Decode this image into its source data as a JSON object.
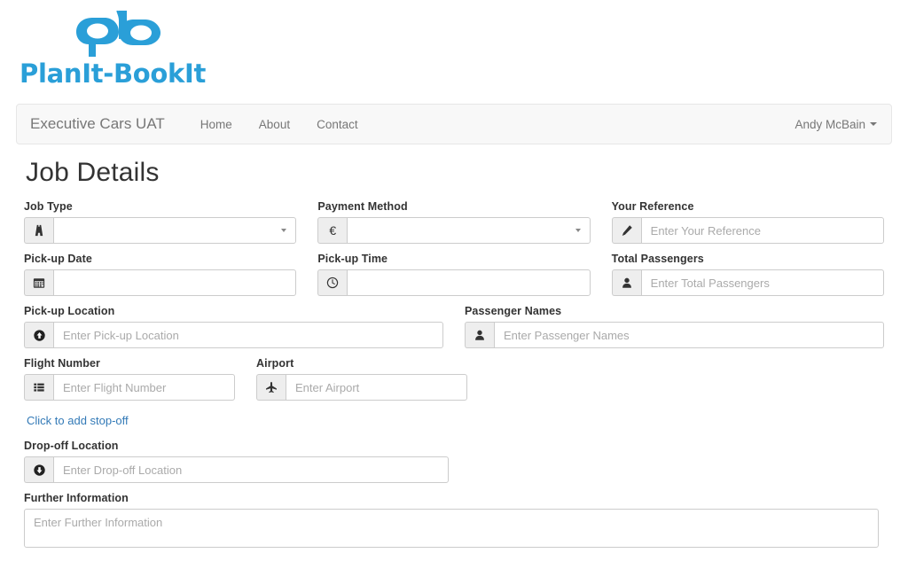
{
  "brand": {
    "logo_text": "PlanIt-BookIt",
    "logo_color": "#2a9fd8",
    "logo_icon": "pb-monogram-icon"
  },
  "navbar": {
    "brand": "Executive Cars UAT",
    "links": [
      {
        "label": "Home"
      },
      {
        "label": "About"
      },
      {
        "label": "Contact"
      }
    ],
    "user": "Andy McBain",
    "user_caret_icon": "chevron-down-icon"
  },
  "page": {
    "title": "Job Details"
  },
  "form": {
    "job_type": {
      "label": "Job Type",
      "icon": "road-icon",
      "value": "",
      "control": "select"
    },
    "payment_method": {
      "label": "Payment Method",
      "icon": "euro-icon",
      "icon_glyph": "€",
      "value": "",
      "control": "select"
    },
    "your_reference": {
      "label": "Your Reference",
      "icon": "pencil-icon",
      "placeholder": "Enter Your Reference",
      "value": ""
    },
    "pickup_date": {
      "label": "Pick-up Date",
      "icon": "calendar-icon",
      "placeholder": "",
      "value": ""
    },
    "pickup_time": {
      "label": "Pick-up Time",
      "icon": "clock-icon",
      "placeholder": "",
      "value": ""
    },
    "total_passengers": {
      "label": "Total Passengers",
      "icon": "user-icon",
      "placeholder": "Enter Total Passengers",
      "value": ""
    },
    "pickup_location": {
      "label": "Pick-up Location",
      "icon": "arrow-circle-up-icon",
      "placeholder": "Enter Pick-up Location",
      "value": ""
    },
    "passenger_names": {
      "label": "Passenger Names",
      "icon": "user-icon",
      "placeholder": "Enter Passenger Names",
      "value": ""
    },
    "flight_number": {
      "label": "Flight Number",
      "icon": "list-icon",
      "placeholder": "Enter Flight Number",
      "value": ""
    },
    "airport": {
      "label": "Airport",
      "icon": "plane-icon",
      "placeholder": "Enter Airport",
      "value": ""
    },
    "add_stopoff": {
      "label": "Click to add stop-off",
      "color": "#337ab7"
    },
    "dropoff_location": {
      "label": "Drop-off Location",
      "icon": "arrow-circle-down-icon",
      "placeholder": "Enter Drop-off Location",
      "value": ""
    },
    "further_information": {
      "label": "Further Information",
      "placeholder": "Enter Further Information",
      "value": ""
    }
  }
}
